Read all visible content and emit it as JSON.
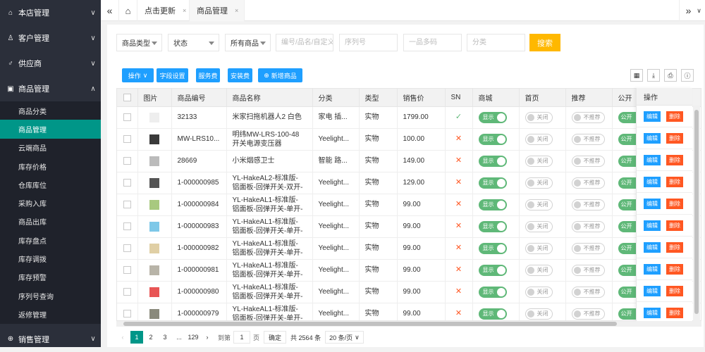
{
  "sidebar": {
    "groups": [
      {
        "label": "本店管理",
        "icon": "home-icon"
      },
      {
        "label": "客户管理",
        "icon": "user-icon"
      },
      {
        "label": "供应商",
        "icon": "male-icon"
      },
      {
        "label": "商品管理",
        "icon": "gift-icon"
      }
    ],
    "subitems": [
      "商品分类",
      "商品管理",
      "云端商品",
      "库存价格",
      "仓库库位",
      "采购入库",
      "商品出库",
      "库存盘点",
      "库存调拨",
      "库存预警",
      "序列号查询",
      "返修管理"
    ],
    "bottom": {
      "label": "销售管理",
      "icon": "cart-icon"
    }
  },
  "tabs": [
    {
      "label": "点击更新",
      "close": "×"
    },
    {
      "label": "商品管理",
      "close": "×"
    }
  ],
  "filters": {
    "type": "商品类型",
    "status": "状态",
    "all": "所有商品",
    "code_placeholder": "编号/品名/自定义",
    "serial_placeholder": "序列号",
    "multi_placeholder": "一品多码",
    "category_placeholder": "分类",
    "search": "搜索"
  },
  "toolbar": {
    "ops": "操作",
    "fields": "字段设置",
    "service": "服务费",
    "install": "安装费",
    "add": "新增商品"
  },
  "columns": [
    "图片",
    "商品编号",
    "商品名称",
    "分类",
    "类型",
    "销售价",
    "SN",
    "商城",
    "首页",
    "推荐",
    "公开",
    "操作"
  ],
  "rows": [
    {
      "img": "#eeeeee",
      "code": "32133",
      "name1": "米家扫拖机器人2 白色",
      "name2": "",
      "cat": "家电 插...",
      "type": "实物",
      "price": "1799.00",
      "sn": "✓"
    },
    {
      "img": "#3a3a3a",
      "code": "MW-LRS10...",
      "name1": "明纬MW-LRS-100-48",
      "name2": "开关电源变压器",
      "cat": "Yeelight...",
      "type": "实物",
      "price": "100.00",
      "sn": "✕"
    },
    {
      "img": "#bbbbbb",
      "code": "28669",
      "name1": "小米烟感卫士",
      "name2": "",
      "cat": "智能 路...",
      "type": "实物",
      "price": "149.00",
      "sn": "✕"
    },
    {
      "img": "#555555",
      "code": "1-000000985",
      "name1": "YL-HakeAL2-标准版-",
      "name2": "铝面板-回弹开关-双开-",
      "cat": "Yeelight...",
      "type": "实物",
      "price": "129.00",
      "sn": "✕"
    },
    {
      "img": "#a8c97f",
      "code": "1-000000984",
      "name1": "YL-HakeAL1-标准版-",
      "name2": "铝面板-回弹开关-单开-",
      "cat": "Yeelight...",
      "type": "实物",
      "price": "99.00",
      "sn": "✕"
    },
    {
      "img": "#7ec8e8",
      "code": "1-000000983",
      "name1": "YL-HakeAL1-标准版-",
      "name2": "铝面板-回弹开关-单开-",
      "cat": "Yeelight...",
      "type": "实物",
      "price": "99.00",
      "sn": "✕"
    },
    {
      "img": "#e0cfa5",
      "code": "1-000000982",
      "name1": "YL-HakeAL1-标准版-",
      "name2": "铝面板-回弹开关-单开-",
      "cat": "Yeelight...",
      "type": "实物",
      "price": "99.00",
      "sn": "✕"
    },
    {
      "img": "#b8b4a8",
      "code": "1-000000981",
      "name1": "YL-HakeAL1-标准版-",
      "name2": "铝面板-回弹开关-单开-",
      "cat": "Yeelight...",
      "type": "实物",
      "price": "99.00",
      "sn": "✕"
    },
    {
      "img": "#e85555",
      "code": "1-000000980",
      "name1": "YL-HakeAL1-标准版-",
      "name2": "铝面板-回弹开关-单开-",
      "cat": "Yeelight...",
      "type": "实物",
      "price": "99.00",
      "sn": "✕"
    },
    {
      "img": "#8a8a7c",
      "code": "1-000000979",
      "name1": "YL-HakeAL1-标准版-",
      "name2": "铝面板-回弹开关-单开-",
      "cat": "Yeelight...",
      "type": "实物",
      "price": "99.00",
      "sn": "✕"
    }
  ],
  "switches": {
    "show": "显示",
    "off": "关闭",
    "not_rec": "不推荐",
    "public": "公开"
  },
  "actions": {
    "edit": "编辑",
    "delete": "删除"
  },
  "pager": {
    "p1": "1",
    "p2": "2",
    "p3": "3",
    "ellipsis": "...",
    "last": "129",
    "goto": "到第",
    "page_val": "1",
    "page": "页",
    "ok": "确定",
    "total": "共 2564 条",
    "per": "20 条/页"
  },
  "colors": {
    "sidebar": "#2b2f3a",
    "active": "#009688",
    "primary": "#1e9fff",
    "warn": "#ffb800",
    "danger": "#ff5722",
    "green": "#5fb878"
  }
}
